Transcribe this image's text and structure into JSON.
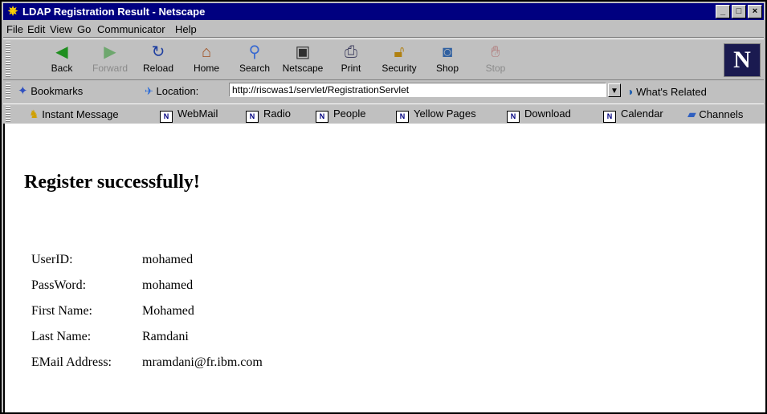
{
  "window": {
    "title": "LDAP Registration Result - Netscape",
    "app_icon": "netscape-app-icon",
    "controls": {
      "minimize": "_",
      "maximize": "□",
      "close": "×"
    }
  },
  "menu": {
    "file": "File",
    "edit": "Edit",
    "view": "View",
    "go": "Go",
    "communicator": "Communicator",
    "help": "Help"
  },
  "toolbar": {
    "back": "Back",
    "forward": "Forward",
    "reload": "Reload",
    "home": "Home",
    "search": "Search",
    "netscape": "Netscape",
    "print": "Print",
    "security": "Security",
    "shop": "Shop",
    "stop": "Stop",
    "logo": "N"
  },
  "location_bar": {
    "bookmarks_label": "Bookmarks",
    "location_label": "Location:",
    "url": "http://riscwas1/servlet/RegistrationServlet",
    "whats_related": "What's Related"
  },
  "personal_toolbar": {
    "instant_message": "Instant Message",
    "webmail": "WebMail",
    "radio": "Radio",
    "people": "People",
    "yellow_pages": "Yellow Pages",
    "download": "Download",
    "calendar": "Calendar",
    "channels": "Channels"
  },
  "page": {
    "heading": "Register successfully!",
    "fields": [
      {
        "label": "UserID:",
        "value": "mohamed"
      },
      {
        "label": "PassWord:",
        "value": "mohamed"
      },
      {
        "label": "First Name:",
        "value": "Mohamed"
      },
      {
        "label": "Last Name:",
        "value": "Ramdani"
      },
      {
        "label": "EMail Address:",
        "value": "mramdani@fr.ibm.com"
      }
    ]
  },
  "colors": {
    "titlebar": "#000080",
    "chrome": "#c0c0c0",
    "content_bg": "#ffffff"
  }
}
